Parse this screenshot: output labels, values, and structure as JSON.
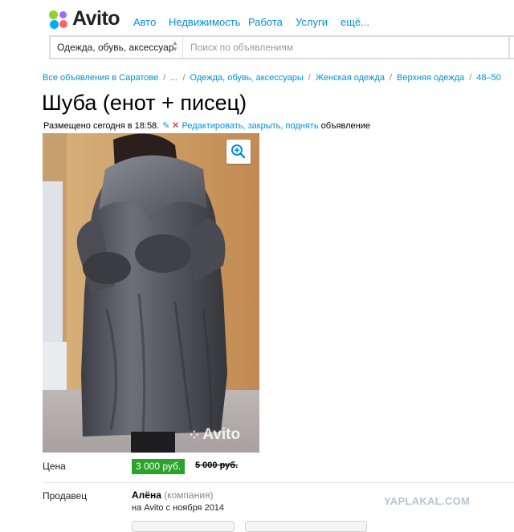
{
  "header": {
    "logo_text": "Avito",
    "nav": [
      "Авто",
      "Недвижимость",
      "Работа",
      "Услуги",
      "ещё..."
    ]
  },
  "search": {
    "category": "Одежда, обувь, аксессуар",
    "placeholder": "Поиск по объявлениям"
  },
  "breadcrumbs": [
    "Все объявления в Саратове",
    "...",
    "Одежда, обувь, аксессуары",
    "Женская одежда",
    "Верхняя одежда",
    "48–50"
  ],
  "listing": {
    "title": "Шуба (енот + писец)",
    "posted": "Размещено сегодня в 18:58.",
    "edit_link": "Редактировать, закрыть, поднять",
    "edit_suffix": "объявление",
    "photo_watermark": "Avito",
    "price_label": "Цена",
    "price": "3 000 руб.",
    "old_price": "5 000 руб.",
    "seller_label": "Продавец",
    "seller_name": "Алёна",
    "seller_type": "(компания)",
    "seller_since": "на Avito с ноября 2014"
  },
  "overlay_watermark": "YAPLAKAL.COM",
  "colors": {
    "link": "#0091d9",
    "price_badge": "#2aa52a"
  },
  "icons": {
    "zoom": "zoom-in-icon",
    "edit": "pencil-icon",
    "close": "cross-icon"
  }
}
